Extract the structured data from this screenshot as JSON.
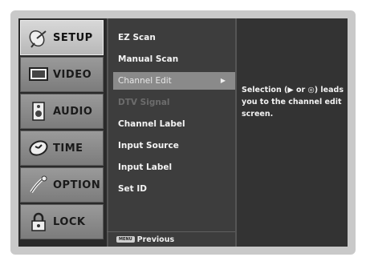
{
  "tabs": [
    {
      "label": "SETUP",
      "icon": "satellite-dish-icon",
      "active": true
    },
    {
      "label": "VIDEO",
      "icon": "tv-icon",
      "active": false
    },
    {
      "label": "AUDIO",
      "icon": "speaker-icon",
      "active": false
    },
    {
      "label": "TIME",
      "icon": "clock-icon",
      "active": false
    },
    {
      "label": "OPTION",
      "icon": "option-icon",
      "active": false
    },
    {
      "label": "LOCK",
      "icon": "lock-icon",
      "active": false
    }
  ],
  "menu": {
    "items": [
      {
        "label": "EZ Scan",
        "state": "normal"
      },
      {
        "label": "Manual Scan",
        "state": "normal"
      },
      {
        "label": "Channel Edit",
        "state": "selected"
      },
      {
        "label": "DTV Signal",
        "state": "disabled"
      },
      {
        "label": "Channel Label",
        "state": "normal"
      },
      {
        "label": "Input Source",
        "state": "normal"
      },
      {
        "label": "Input Label",
        "state": "normal"
      },
      {
        "label": "Set ID",
        "state": "normal"
      }
    ],
    "selected_arrow": "▶"
  },
  "footer": {
    "key_label": "MENU",
    "previous_label": "Previous"
  },
  "description": {
    "text": "Selection (▶ or ◎) leads you to the channel edit screen."
  },
  "colors": {
    "frame": "#c9c9c9",
    "active_tab": "#c8c8c8",
    "selected_item": "#8a8a8a",
    "disabled_text": "#6c6c6c"
  }
}
